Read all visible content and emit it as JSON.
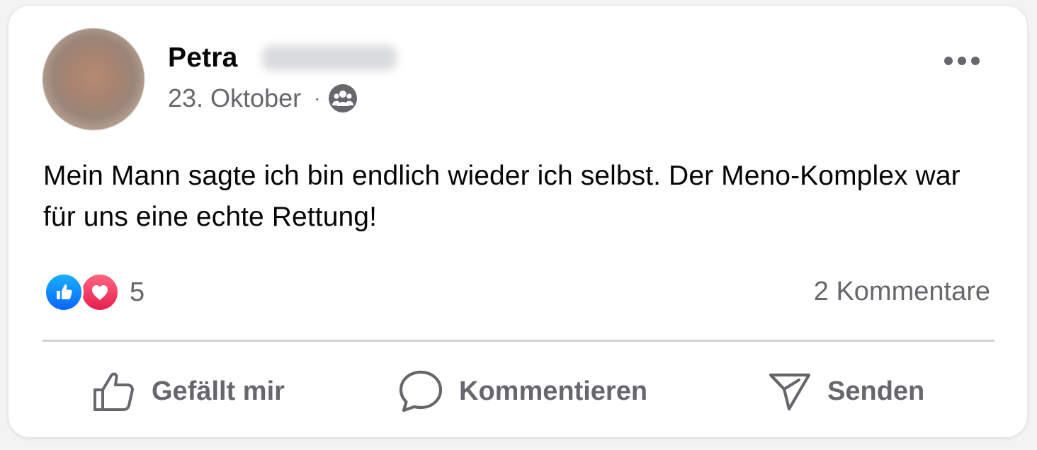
{
  "post": {
    "author_first_name": "Petra",
    "date": "23. Oktober",
    "separator": "·",
    "audience_icon": "group-icon",
    "text": "Mein Mann sagte ich bin endlich wieder ich selbst. Der Meno-Komplex war für uns eine echte Rettung!",
    "more_icon": "more-options-icon"
  },
  "stats": {
    "reaction_icons": [
      "like-reaction-icon",
      "love-reaction-icon"
    ],
    "reaction_count": "5",
    "comments_label": "2 Kommentare"
  },
  "actions": {
    "like_label": "Gefällt mir",
    "comment_label": "Kommentieren",
    "share_label": "Senden"
  },
  "colors": {
    "text_primary": "#050505",
    "text_secondary": "#65676b",
    "divider": "#ced0d4",
    "like_blue": "#0866ff",
    "love_red": "#e61e4d"
  }
}
